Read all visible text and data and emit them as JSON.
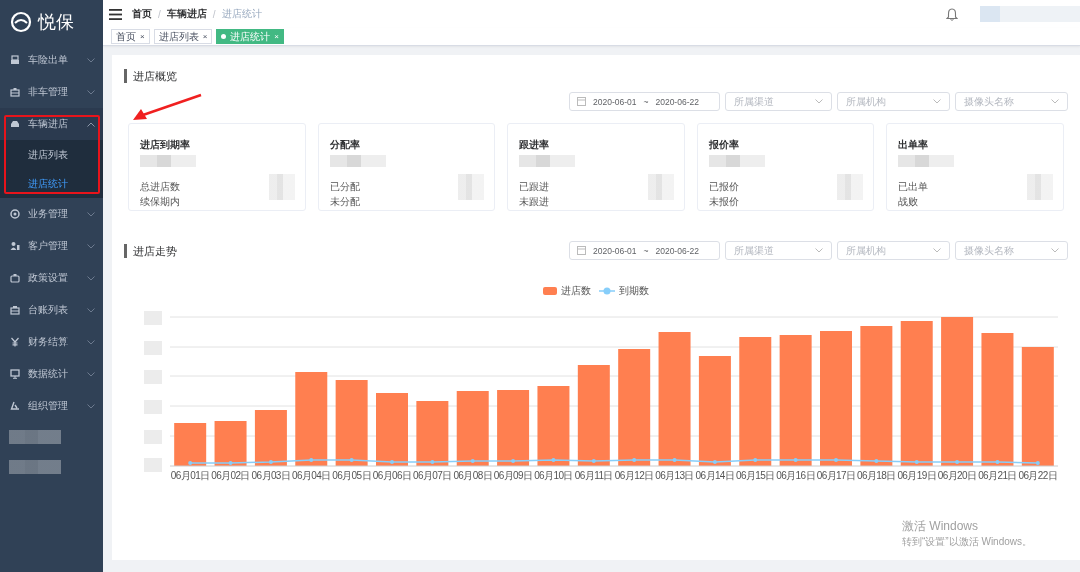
{
  "sidebar": {
    "logo": "悦保",
    "items": [
      {
        "label": "车险出单",
        "expanded": false
      },
      {
        "label": "非车管理",
        "expanded": false
      },
      {
        "label": "车辆进店",
        "expanded": true,
        "children": [
          {
            "label": "进店列表",
            "selected": false
          },
          {
            "label": "进店统计",
            "selected": true
          }
        ]
      },
      {
        "label": "业务管理",
        "expanded": false
      },
      {
        "label": "客户管理",
        "expanded": false
      },
      {
        "label": "政策设置",
        "expanded": false
      },
      {
        "label": "台账列表",
        "expanded": false
      },
      {
        "label": "财务结算",
        "expanded": false
      },
      {
        "label": "数据统计",
        "expanded": false
      },
      {
        "label": "组织管理",
        "expanded": false
      }
    ]
  },
  "breadcrumb": {
    "separator": "/",
    "items": [
      "首页",
      "车辆进店",
      "进店统计"
    ]
  },
  "tabs": [
    {
      "label": "首页",
      "close": "×",
      "selected": false
    },
    {
      "label": "进店列表",
      "close": "×",
      "selected": false
    },
    {
      "label": "进店统计",
      "close": "×",
      "selected": true
    }
  ],
  "overview": {
    "title": "进店概览",
    "filters": {
      "date_start": "2020-06-01",
      "separator": "~",
      "date_end": "2020-06-22",
      "selects": [
        "所属渠道",
        "所属机构",
        "摄像头名称"
      ]
    },
    "cards": [
      {
        "title": "进店到期率",
        "lines": [
          "总进店数",
          "续保期内"
        ]
      },
      {
        "title": "分配率",
        "lines": [
          "已分配",
          "未分配"
        ]
      },
      {
        "title": "跟进率",
        "lines": [
          "已跟进",
          "未跟进"
        ]
      },
      {
        "title": "报价率",
        "lines": [
          "已报价",
          "未报价"
        ]
      },
      {
        "title": "出单率",
        "lines": [
          "已出单",
          "战败"
        ]
      }
    ]
  },
  "trend": {
    "title": "进店走势",
    "filters": {
      "date_start": "2020-06-01",
      "separator": "~",
      "date_end": "2020-06-22",
      "selects": [
        "所属渠道",
        "所属机构",
        "摄像头名称"
      ]
    },
    "legend": [
      {
        "label": "进店数",
        "kind": "bar",
        "color": "#ff7f50"
      },
      {
        "label": "到期数",
        "kind": "line",
        "color": "#87cefa"
      }
    ],
    "x_labels": [
      "06月01日",
      "06月02日",
      "06月03日",
      "06月04日",
      "06月05日",
      "06月06日",
      "06月07日",
      "06月08日",
      "06月09日",
      "06月10日",
      "06月11日",
      "06月12日",
      "06月13日",
      "06月14日",
      "06月15日",
      "06月16日",
      "06月17日",
      "06月18日",
      "06月19日",
      "06月20日",
      "06月21日",
      "06月22日"
    ]
  },
  "os_notice": {
    "title": "激活 Windows",
    "subtitle": "转到“设置”以激活 Windows。"
  }
}
